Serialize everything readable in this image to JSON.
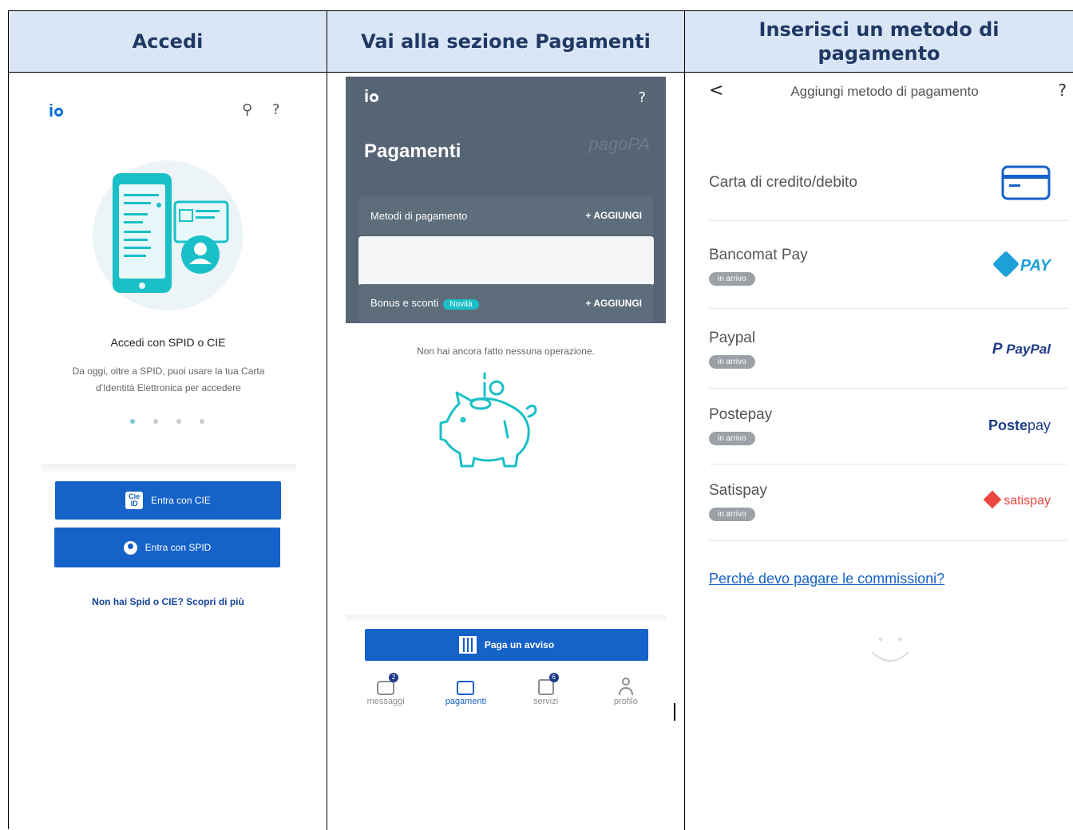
{
  "headers": [
    "Accedi",
    "Vai alla sezione Pagamenti",
    "Inserisci un metodo di pagamento"
  ],
  "login": {
    "logo": "io",
    "title": "Accedi con SPID o CIE",
    "description": "Da oggi, oltre a SPID, puoi usare la tua Carta d'Identità Elettronica per accedere",
    "carousel": {
      "pages": 4,
      "active": 1
    },
    "cie_label": "Entra con CIE",
    "cie_badge": "Cie ID",
    "spid_label": "Entra con SPID",
    "link": "Non hai Spid o CIE? Scopri di più"
  },
  "payments": {
    "logo": "io",
    "help": "?",
    "title": "Pagamenti",
    "brand": "pagoPA",
    "methods_label": "Metodi di pagamento",
    "add_label": "+ AGGIUNGI",
    "bonus_label": "Bonus e sconti",
    "bonus_badge": "Novità",
    "empty": "Non hai ancora fatto nessuna operazione.",
    "pay_button": "Paga un avviso",
    "tabs": [
      {
        "label": "messaggi",
        "count": "2"
      },
      {
        "label": "pagamenti",
        "count": ""
      },
      {
        "label": "servizi",
        "count": "6"
      },
      {
        "label": "profilo",
        "count": ""
      }
    ]
  },
  "add_method": {
    "back": "<",
    "title": "Aggiungi metodo di pagamento",
    "help": "?",
    "methods": [
      {
        "name": "Carta di credito/debito",
        "soon": "",
        "logo": "card"
      },
      {
        "name": "Bancomat Pay",
        "soon": "in arrivo",
        "logo": "PAY"
      },
      {
        "name": "Paypal",
        "soon": "in arrivo",
        "logo": "PayPal"
      },
      {
        "name": "Postepay",
        "soon": "in arrivo",
        "logo_a": "Poste",
        "logo_b": "pay"
      },
      {
        "name": "Satispay",
        "soon": "in arrivo",
        "logo": "satispay"
      }
    ],
    "faq": "Perché devo pagare le commissioni?"
  },
  "colors": {
    "header_bg": "#dae6f5",
    "header_text": "#1f3864",
    "primary": "#1562c8",
    "dark_panel": "#566574",
    "teal": "#19c0c7"
  }
}
